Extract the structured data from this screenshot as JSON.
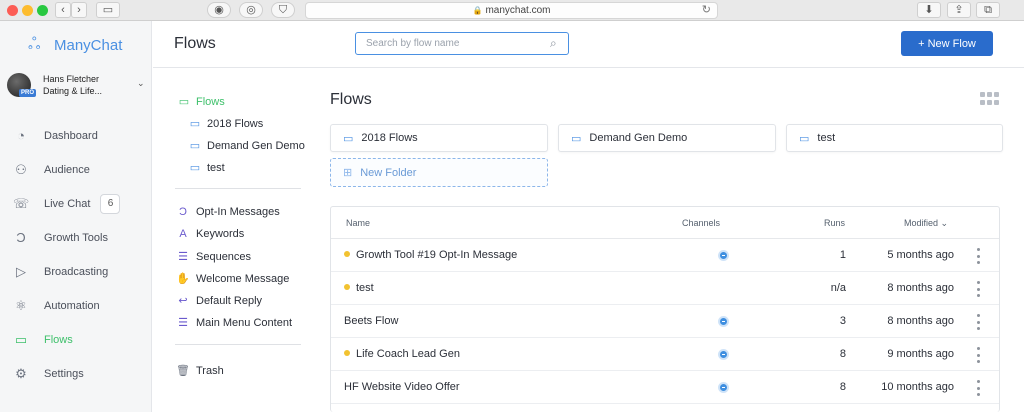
{
  "browser": {
    "url": "manychat.com",
    "back": "‹",
    "forward": "›"
  },
  "sidebar": {
    "brand": "ManyChat",
    "user": {
      "name": "Hans Fletcher",
      "page": "Dating & Life...",
      "badge": "PRO"
    },
    "items": [
      {
        "label": "Dashboard",
        "icon": "dashboard-icon"
      },
      {
        "label": "Audience",
        "icon": "audience-icon"
      },
      {
        "label": "Live Chat",
        "icon": "live-chat-icon",
        "badge": "6"
      },
      {
        "label": "Growth Tools",
        "icon": "growth-tools-icon"
      },
      {
        "label": "Broadcasting",
        "icon": "broadcasting-icon"
      },
      {
        "label": "Automation",
        "icon": "automation-icon"
      },
      {
        "label": "Flows",
        "icon": "flows-icon",
        "active": true
      },
      {
        "label": "Settings",
        "icon": "settings-icon"
      }
    ]
  },
  "topbar": {
    "title": "Flows",
    "search_placeholder": "Search by flow name",
    "new_flow": "+ New Flow"
  },
  "tree": {
    "root": "Flows",
    "folders": [
      "2018 Flows",
      "Demand Gen Demo",
      "test"
    ],
    "system": [
      "Opt-In Messages",
      "Keywords",
      "Sequences",
      "Welcome Message",
      "Default Reply",
      "Main Menu Content"
    ],
    "trash": "Trash"
  },
  "main": {
    "title": "Flows",
    "folders": [
      "2018 Flows",
      "Demand Gen Demo",
      "test"
    ],
    "new_folder": "New Folder"
  },
  "table": {
    "columns": {
      "name": "Name",
      "channels": "Channels",
      "runs": "Runs",
      "modified": "Modified"
    },
    "rows": [
      {
        "name": "Growth Tool #19 Opt-In Message",
        "dot": true,
        "channel": true,
        "runs": "1",
        "modified": "5 months ago"
      },
      {
        "name": "test",
        "dot": true,
        "channel": false,
        "runs": "n/a",
        "modified": "8 months ago"
      },
      {
        "name": "Beets Flow",
        "dot": false,
        "channel": true,
        "runs": "3",
        "modified": "8 months ago"
      },
      {
        "name": "Life Coach Lead Gen",
        "dot": true,
        "channel": true,
        "runs": "8",
        "modified": "9 months ago"
      },
      {
        "name": "HF Website Video Offer",
        "dot": false,
        "channel": true,
        "runs": "8",
        "modified": "10 months ago"
      }
    ]
  },
  "colors": {
    "accent": "#2a6ccc",
    "active_green": "#3ec06b",
    "draft_dot": "#f2c230"
  }
}
